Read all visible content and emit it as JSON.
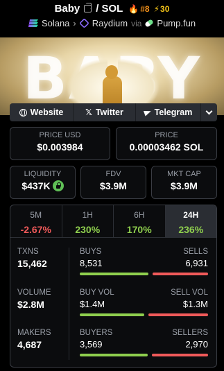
{
  "token": {
    "name": "Baby",
    "separator": "/",
    "quote": "SOL",
    "rank": "#8",
    "boost": "30"
  },
  "chain": {
    "network": "Solana",
    "dex": "Raydium",
    "via_label": "via",
    "launchpad": "Pump.fun"
  },
  "banner": {
    "text": "BABY"
  },
  "links": {
    "website": "Website",
    "twitter": "Twitter",
    "telegram": "Telegram"
  },
  "price": {
    "usd_label": "PRICE USD",
    "usd_value": "$0.003984",
    "native_label": "PRICE",
    "native_value": "0.00003462 SOL"
  },
  "metrics": {
    "liquidity_label": "LIQUIDITY",
    "liquidity_value": "$437K",
    "fdv_label": "FDV",
    "fdv_value": "$3.9M",
    "mktcap_label": "MKT CAP",
    "mktcap_value": "$3.9M"
  },
  "timeframes": [
    {
      "label": "5M",
      "value": "-2.67%",
      "direction": "down"
    },
    {
      "label": "1H",
      "value": "230%",
      "direction": "up"
    },
    {
      "label": "6H",
      "value": "170%",
      "direction": "up"
    },
    {
      "label": "24H",
      "value": "236%",
      "direction": "up",
      "active": true
    }
  ],
  "stats": {
    "txns_label": "TXNS",
    "txns_value": "15,462",
    "volume_label": "VOLUME",
    "volume_value": "$2.8M",
    "makers_label": "MAKERS",
    "makers_value": "4,687",
    "buys_label": "BUYS",
    "sells_label": "SELLS",
    "buys_value": "8,531",
    "sells_value": "6,931",
    "buy_vol_label": "BUY VOL",
    "sell_vol_label": "SELL VOL",
    "buy_vol_value": "$1.4M",
    "sell_vol_value": "$1.3M",
    "buyers_label": "BUYERS",
    "sellers_label": "SELLERS",
    "buyers_value": "3,569",
    "sellers_value": "2,970",
    "buys_ratio": 0.552,
    "buy_vol_ratio": 0.519,
    "buyers_ratio": 0.546
  },
  "colors": {
    "positive": "#8fcf4e",
    "negative": "#f05a5a",
    "accent_orange": "#f7931a",
    "accent_yellow": "#f5c518"
  }
}
